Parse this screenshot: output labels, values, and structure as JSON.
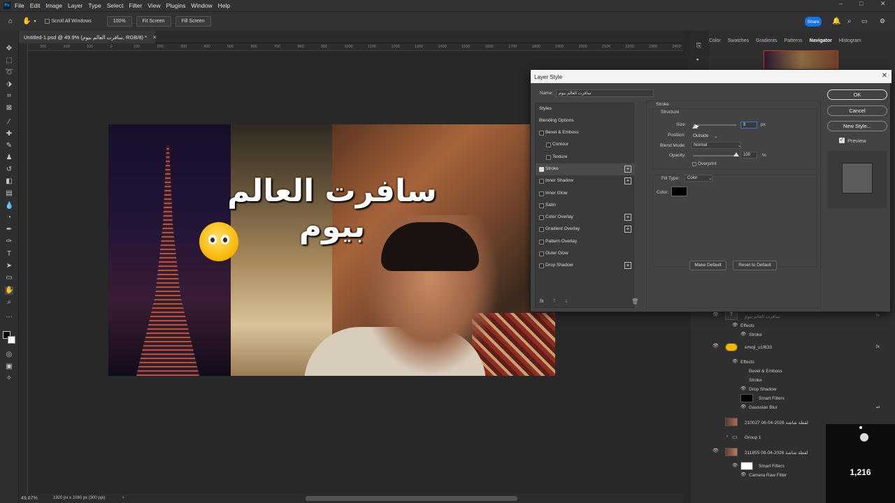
{
  "app": {
    "menu": [
      "File",
      "Edit",
      "Image",
      "Layer",
      "Type",
      "Select",
      "Filter",
      "View",
      "Plugins",
      "Window",
      "Help"
    ],
    "window_controls": [
      "–",
      "□",
      "✕"
    ]
  },
  "options_bar": {
    "scroll_all_windows": "Scroll All Windows",
    "zoom_100": "100%",
    "fit_screen": "Fit Screen",
    "fill_screen": "Fill Screen",
    "share": "Share"
  },
  "document": {
    "tab_title": "Untitled-1.psd @ 49.9% (سافرت العالم بيوم, RGB/8) *",
    "zoom": "49.87%",
    "doc_info": "1920 px x 1080 px (300 ppi)",
    "ruler_ticks": [
      "300",
      "200",
      "100",
      "0",
      "100",
      "200",
      "300",
      "400",
      "500",
      "600",
      "700",
      "800",
      "900",
      "1000",
      "1100",
      "1200",
      "1300",
      "1400",
      "1500",
      "1600",
      "1700",
      "1800",
      "1900",
      "2000",
      "2100",
      "2200",
      "2300",
      "2400"
    ]
  },
  "canvas_image": {
    "headline": "سافرت العالم بيوم"
  },
  "panels": {
    "tabs": [
      "Color",
      "Swatches",
      "Gradients",
      "Patterns",
      "Navigator",
      "Histogram"
    ],
    "active_tab": "Navigator"
  },
  "dialog": {
    "title": "Layer Style",
    "name_label": "Name:",
    "name_value": "سافرت العالم بيوم",
    "styles_header": "Styles",
    "blending_options": "Blending Options",
    "styles": [
      {
        "label": "Bevel & Emboss",
        "checked": false,
        "plus": false,
        "indent": false
      },
      {
        "label": "Contour",
        "checked": false,
        "plus": false,
        "indent": true
      },
      {
        "label": "Texture",
        "checked": false,
        "plus": false,
        "indent": true
      },
      {
        "label": "Stroke",
        "checked": true,
        "plus": true,
        "indent": false
      },
      {
        "label": "Inner Shadow",
        "checked": false,
        "plus": true,
        "indent": false
      },
      {
        "label": "Inner Glow",
        "checked": false,
        "plus": false,
        "indent": false
      },
      {
        "label": "Satin",
        "checked": false,
        "plus": false,
        "indent": false
      },
      {
        "label": "Color Overlay",
        "checked": false,
        "plus": true,
        "indent": false
      },
      {
        "label": "Gradient Overlay",
        "checked": false,
        "plus": true,
        "indent": false
      },
      {
        "label": "Pattern Overlay",
        "checked": false,
        "plus": false,
        "indent": false
      },
      {
        "label": "Outer Glow",
        "checked": false,
        "plus": false,
        "indent": false
      },
      {
        "label": "Drop Shadow",
        "checked": false,
        "plus": true,
        "indent": false
      }
    ],
    "stroke": {
      "section": "Stroke",
      "structure": "Structure",
      "size_label": "Size:",
      "size_value": "8",
      "size_unit": "px",
      "position_label": "Position:",
      "position_value": "Outside",
      "blend_label": "Blend Mode:",
      "blend_value": "Normal",
      "opacity_label": "Opacity:",
      "opacity_value": "100",
      "opacity_unit": "%",
      "overprint": "Overprint",
      "fill_type_label": "Fill Type:",
      "fill_type_value": "Color",
      "color_label": "Color:",
      "color_swatch": "#000000",
      "make_default": "Make Default",
      "reset_default": "Reset to Default"
    },
    "buttons": {
      "ok": "OK",
      "cancel": "Cancel",
      "new_style": "New Style...",
      "preview": "Preview"
    },
    "fx": "fx"
  },
  "layers": [
    {
      "name": "سافرت العالم بيوم",
      "kind": "text"
    },
    {
      "name": "Effects",
      "kind": "effects"
    },
    {
      "name": "Stroke",
      "kind": "effect"
    },
    {
      "name": "emoji_u1f633",
      "kind": "layer"
    },
    {
      "name": "Effects",
      "kind": "effects"
    },
    {
      "name": "Bevel & Emboss",
      "kind": "effect"
    },
    {
      "name": "Stroke",
      "kind": "effect"
    },
    {
      "name": "Drop Shadow",
      "kind": "effect"
    },
    {
      "name": "Smart Filters",
      "kind": "filter"
    },
    {
      "name": "Gaussian Blur",
      "kind": "effect"
    },
    {
      "name": "لقطة شاشة 2026-04-08 210027",
      "kind": "layer"
    },
    {
      "name": "Group 1",
      "kind": "group"
    },
    {
      "name": "لقطة شاشة 2026-04-08 211855",
      "kind": "layer"
    },
    {
      "name": "Smart Filters",
      "kind": "filter"
    },
    {
      "name": "Camera Raw Filter",
      "kind": "effect"
    }
  ],
  "overlay": {
    "count": "1,216"
  },
  "colors": {
    "accent": "#1473e6",
    "dialog_bg": "#434343",
    "panel_bg": "#2f2f2f"
  }
}
